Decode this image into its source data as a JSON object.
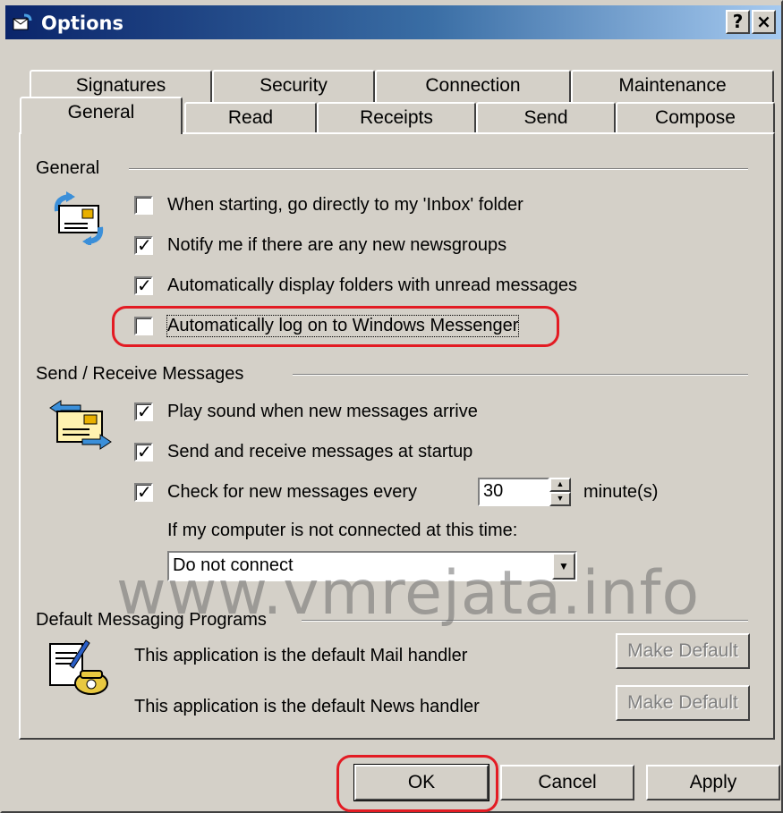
{
  "window": {
    "title": "Options",
    "help_button": "?",
    "close_button": "×"
  },
  "tabs_back": [
    {
      "label": "Signatures"
    },
    {
      "label": "Security"
    },
    {
      "label": "Connection"
    },
    {
      "label": "Maintenance"
    }
  ],
  "tabs_front": [
    {
      "label": "General",
      "active": true
    },
    {
      "label": "Read"
    },
    {
      "label": "Receipts"
    },
    {
      "label": "Send"
    },
    {
      "label": "Compose"
    }
  ],
  "general": {
    "title": "General",
    "options": [
      {
        "label": "When starting, go directly to my 'Inbox' folder",
        "checked": false
      },
      {
        "label": "Notify me if there are any new newsgroups",
        "checked": true
      },
      {
        "label": "Automatically display folders with unread messages",
        "checked": true
      },
      {
        "label": "Automatically log on to Windows Messenger",
        "checked": false
      }
    ]
  },
  "send_receive": {
    "title": "Send / Receive Messages",
    "play_sound": {
      "label": "Play sound when new messages arrive",
      "checked": true
    },
    "send_at_startup": {
      "label": "Send and receive messages at startup",
      "checked": true
    },
    "check_every": {
      "label": "Check for new messages every",
      "checked": true,
      "value": "30",
      "unit": "minute(s)"
    },
    "not_connected_label": "If my computer is not connected at this time:",
    "connection_select": "Do not connect"
  },
  "default_programs": {
    "title": "Default Messaging Programs",
    "mail_text": "This application is the default Mail handler",
    "news_text": "This application is the default News handler",
    "make_default_label": "Make Default"
  },
  "buttons": {
    "ok": "OK",
    "cancel": "Cancel",
    "apply": "Apply"
  },
  "watermark": "www.vmrejata.info",
  "colors": {
    "highlight": "#e31b23",
    "titlebar_start": "#0a246a",
    "dialog_face": "#d4d0c8"
  }
}
